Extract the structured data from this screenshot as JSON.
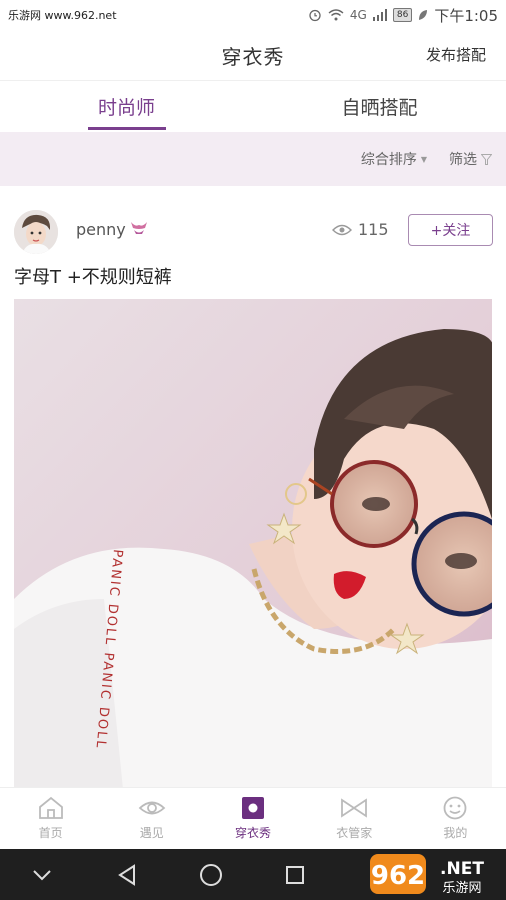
{
  "status_bar": {
    "watermark": "乐游网 www.962.net",
    "signal_text": "4G",
    "battery": "86",
    "time": "下午1:05"
  },
  "header": {
    "title": "穿衣秀",
    "publish": "发布搭配"
  },
  "tabs": [
    {
      "label": "时尚师",
      "active": true
    },
    {
      "label": "自晒搭配",
      "active": false
    }
  ],
  "filters": {
    "sort": "综合排序",
    "filter": "筛选"
  },
  "post": {
    "username": "penny",
    "views": "115",
    "follow": "+关注",
    "title": "字母T +不规则短裤",
    "shirt_text": "PANIC DOLL PANIC DOLL"
  },
  "bottom_nav": [
    {
      "label": "首页",
      "icon": "home-icon",
      "active": false
    },
    {
      "label": "遇见",
      "icon": "eye-icon",
      "active": false
    },
    {
      "label": "穿衣秀",
      "icon": "show-icon",
      "active": true
    },
    {
      "label": "衣管家",
      "icon": "bow-icon",
      "active": false
    },
    {
      "label": "我的",
      "icon": "face-icon",
      "active": false
    }
  ],
  "watermark_logo": {
    "number": "962",
    "suffix": ".NET",
    "sub": "乐游网"
  },
  "colors": {
    "accent": "#7a3f8e",
    "filter_bg": "#f3ecf3",
    "sys_nav": "#1f1f1f"
  }
}
